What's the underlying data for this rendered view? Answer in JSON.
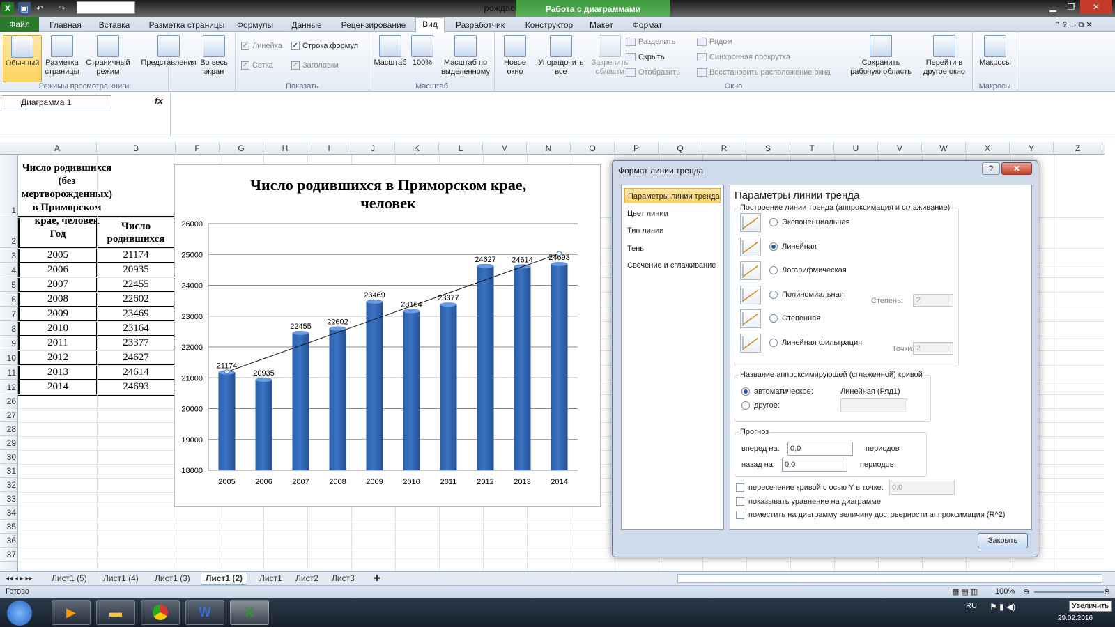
{
  "window": {
    "title": "рождаемость в ПК  -  Microsoft Excel",
    "context_tab_header": "Работа с диаграммами"
  },
  "tabs": [
    "Файл",
    "Главная",
    "Вставка",
    "Разметка страницы",
    "Формулы",
    "Данные",
    "Рецензирование",
    "Вид",
    "Разработчик",
    "Конструктор",
    "Макет",
    "Формат"
  ],
  "ribbon": {
    "groups": {
      "views": "Режимы просмотра книги",
      "show": "Показать",
      "zoom": "Масштаб",
      "window": "Окно",
      "macros": "Макросы"
    },
    "views": {
      "normal": "Обычный",
      "page_layout": "Разметка страницы",
      "page_break": "Страничный режим",
      "custom": "Представления",
      "fullscreen": "Во весь экран"
    },
    "show": {
      "ruler": "Линейка",
      "formula_bar": "Строка формул",
      "grid": "Сетка",
      "headings": "Заголовки"
    },
    "zoom": {
      "zoom": "Масштаб",
      "hundred": "100%",
      "to_selection": "Масштаб по выделенному"
    },
    "window": {
      "new": "Новое окно",
      "arrange": "Упорядочить все",
      "freeze": "Закрепить области",
      "split": "Разделить",
      "hide": "Скрыть",
      "unhide": "Отобразить",
      "side": "Рядом",
      "sync": "Синхронная прокрутка",
      "reset": "Восстановить расположение окна",
      "save_ws": "Сохранить рабочую область",
      "switch": "Перейти в другое окно"
    },
    "macros": {
      "macros": "Макросы"
    }
  },
  "formula_bar": {
    "name_box": "Диаграмма 1",
    "fx": "fx"
  },
  "columns": [
    "A",
    "B",
    "F",
    "G",
    "H",
    "I",
    "J",
    "K",
    "L",
    "M",
    "N",
    "O",
    "P",
    "Q",
    "R",
    "S",
    "T",
    "U",
    "V",
    "W",
    "X",
    "Y",
    "Z"
  ],
  "rows": [
    "1",
    "2",
    "3",
    "4",
    "5",
    "6",
    "7",
    "8",
    "9",
    "10",
    "11",
    "12",
    "26",
    "27",
    "28",
    "29",
    "30",
    "31",
    "32",
    "33",
    "34",
    "35",
    "36",
    "37"
  ],
  "table": {
    "title": "Число родившихся (без мертворожденных) в Приморском крае, человек",
    "header_year": "Год",
    "header_count": "Число родившихся",
    "rows": [
      [
        "2005",
        "21174"
      ],
      [
        "2006",
        "20935"
      ],
      [
        "2007",
        "22455"
      ],
      [
        "2008",
        "22602"
      ],
      [
        "2009",
        "23469"
      ],
      [
        "2010",
        "23164"
      ],
      [
        "2011",
        "23377"
      ],
      [
        "2012",
        "24627"
      ],
      [
        "2013",
        "24614"
      ],
      [
        "2014",
        "24693"
      ]
    ]
  },
  "chart_data": {
    "type": "bar",
    "title": "Число родившихся в Приморском крае, человек",
    "categories": [
      "2005",
      "2006",
      "2007",
      "2008",
      "2009",
      "2010",
      "2011",
      "2012",
      "2013",
      "2014"
    ],
    "series": [
      {
        "values": [
          21174,
          20935,
          22455,
          22602,
          23469,
          23164,
          23377,
          24627,
          24614,
          24693
        ],
        "color": "#3a74c4"
      }
    ],
    "ylim": [
      18000,
      26000
    ],
    "yticks": [
      "18000",
      "19000",
      "20000",
      "21000",
      "22000",
      "23000",
      "24000",
      "25000",
      "26000"
    ],
    "data_labels": true,
    "trendline": "linear",
    "grid": true,
    "legend": "none"
  },
  "dialog": {
    "title": "Формат линии тренда",
    "nav": [
      "Параметры линии тренда",
      "Цвет линии",
      "Тип линии",
      "Тень",
      "Свечение и сглаживание"
    ],
    "heading": "Параметры линии тренда",
    "build_label": "Построение линии тренда (аппроксимация и сглаживание)",
    "types": [
      "Экспоненциальная",
      "Линейная",
      "Логарифмическая",
      "Полиномиальная",
      "Степенная",
      "Линейная фильтрация"
    ],
    "degree_label": "Степень:",
    "degree_value": "2",
    "points_label": "Точки:",
    "points_value": "2",
    "name_label": "Название аппроксимирующей (сглаженной) кривой",
    "name_auto": "автоматическое:",
    "name_auto_value": "Линейная (Ряд1)",
    "name_other": "другое:",
    "forecast_label": "Прогноз",
    "forward_label": "вперед на:",
    "forward_value": "0,0",
    "backward_label": "назад на:",
    "backward_value": "0,0",
    "periods": "периодов",
    "intercept": "пересечение кривой с осью Y в точке:",
    "intercept_value": "0,0",
    "show_eq": "показывать уравнение на диаграмме",
    "show_r2": "поместить на диаграмму величину достоверности аппроксимации (R^2)",
    "close": "Закрыть"
  },
  "sheet_tabs": [
    "Лист1 (5)",
    "Лист1 (4)",
    "Лист1 (3)",
    "Лист1 (2)",
    "Лист1",
    "Лист2",
    "Лист3"
  ],
  "status": {
    "ready": "Готово",
    "zoom": "100%",
    "tooltip": "Увеличить"
  },
  "taskbar": {
    "lang": "RU",
    "date": "29.02.2016"
  }
}
